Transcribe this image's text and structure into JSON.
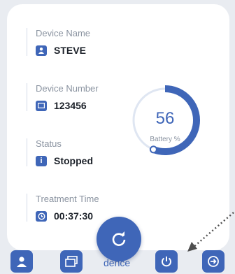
{
  "device_name": {
    "label": "Device Name",
    "value": "STEVE",
    "icon": "user-icon"
  },
  "device_number": {
    "label": "Device Number",
    "value": "123456",
    "icon": "monitor-icon"
  },
  "status": {
    "label": "Status",
    "value": "Stopped",
    "icon": "info-icon"
  },
  "treatment_time": {
    "label": "Treatment Time",
    "value": "00:37:30",
    "icon": "clock-icon"
  },
  "battery": {
    "value": "56",
    "label": "Battery %",
    "level_percent": 56
  },
  "bottom_nav": {
    "items": [
      "user-icon",
      "windows-icon",
      "refresh-icon",
      "power-icon",
      "logout-icon"
    ],
    "partial_text": "dence"
  },
  "colors": {
    "accent": "#3f66b8",
    "gauge_track": "#dfe6f2",
    "background": "#e9ecf1"
  }
}
